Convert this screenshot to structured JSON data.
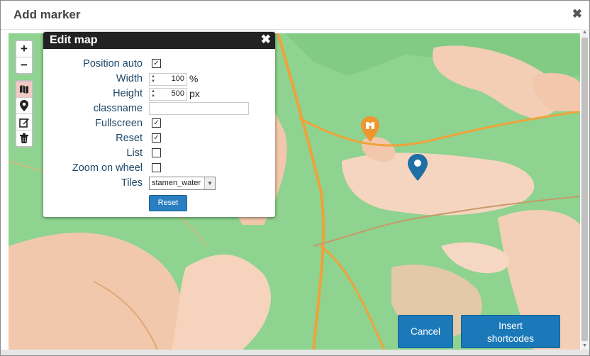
{
  "dialog": {
    "title": "Add marker",
    "close_glyph": "✖"
  },
  "map_controls": {
    "zoom_in": "+",
    "zoom_out": "−",
    "tools": [
      {
        "name": "map-icon",
        "glyph": "🗺",
        "active": true
      },
      {
        "name": "marker-icon",
        "glyph": "⬤",
        "active": false
      },
      {
        "name": "edit-icon",
        "glyph": "✎",
        "active": false
      },
      {
        "name": "trash-icon",
        "glyph": "🗑",
        "active": false
      }
    ]
  },
  "edit_map": {
    "title": "Edit map",
    "close_glyph": "✖",
    "position_auto": {
      "label": "Position auto",
      "checked": true
    },
    "width": {
      "label": "Width",
      "value": "100",
      "unit": "%"
    },
    "height": {
      "label": "Height",
      "value": "500",
      "unit": "px"
    },
    "classname": {
      "label": "classname",
      "value": ""
    },
    "fullscreen": {
      "label": "Fullscreen",
      "checked": true
    },
    "reset": {
      "label": "Reset",
      "checked": true
    },
    "list": {
      "label": "List",
      "checked": false
    },
    "zoom_on_wheel": {
      "label": "Zoom on wheel",
      "checked": false
    },
    "tiles": {
      "label": "Tiles",
      "selected": "stamen_water"
    },
    "reset_button": "Reset"
  },
  "markers": [
    {
      "name": "orange-binoculars-marker",
      "color": "#f0962f"
    },
    {
      "name": "blue-marker",
      "color": "#1f6ea6"
    }
  ],
  "footer": {
    "cancel": "Cancel",
    "insert_line1": "Insert",
    "insert_line2": "shortcodes"
  },
  "colors": {
    "accent": "#1b79b9",
    "panel_header": "#222222",
    "label_text": "#1e4666"
  }
}
